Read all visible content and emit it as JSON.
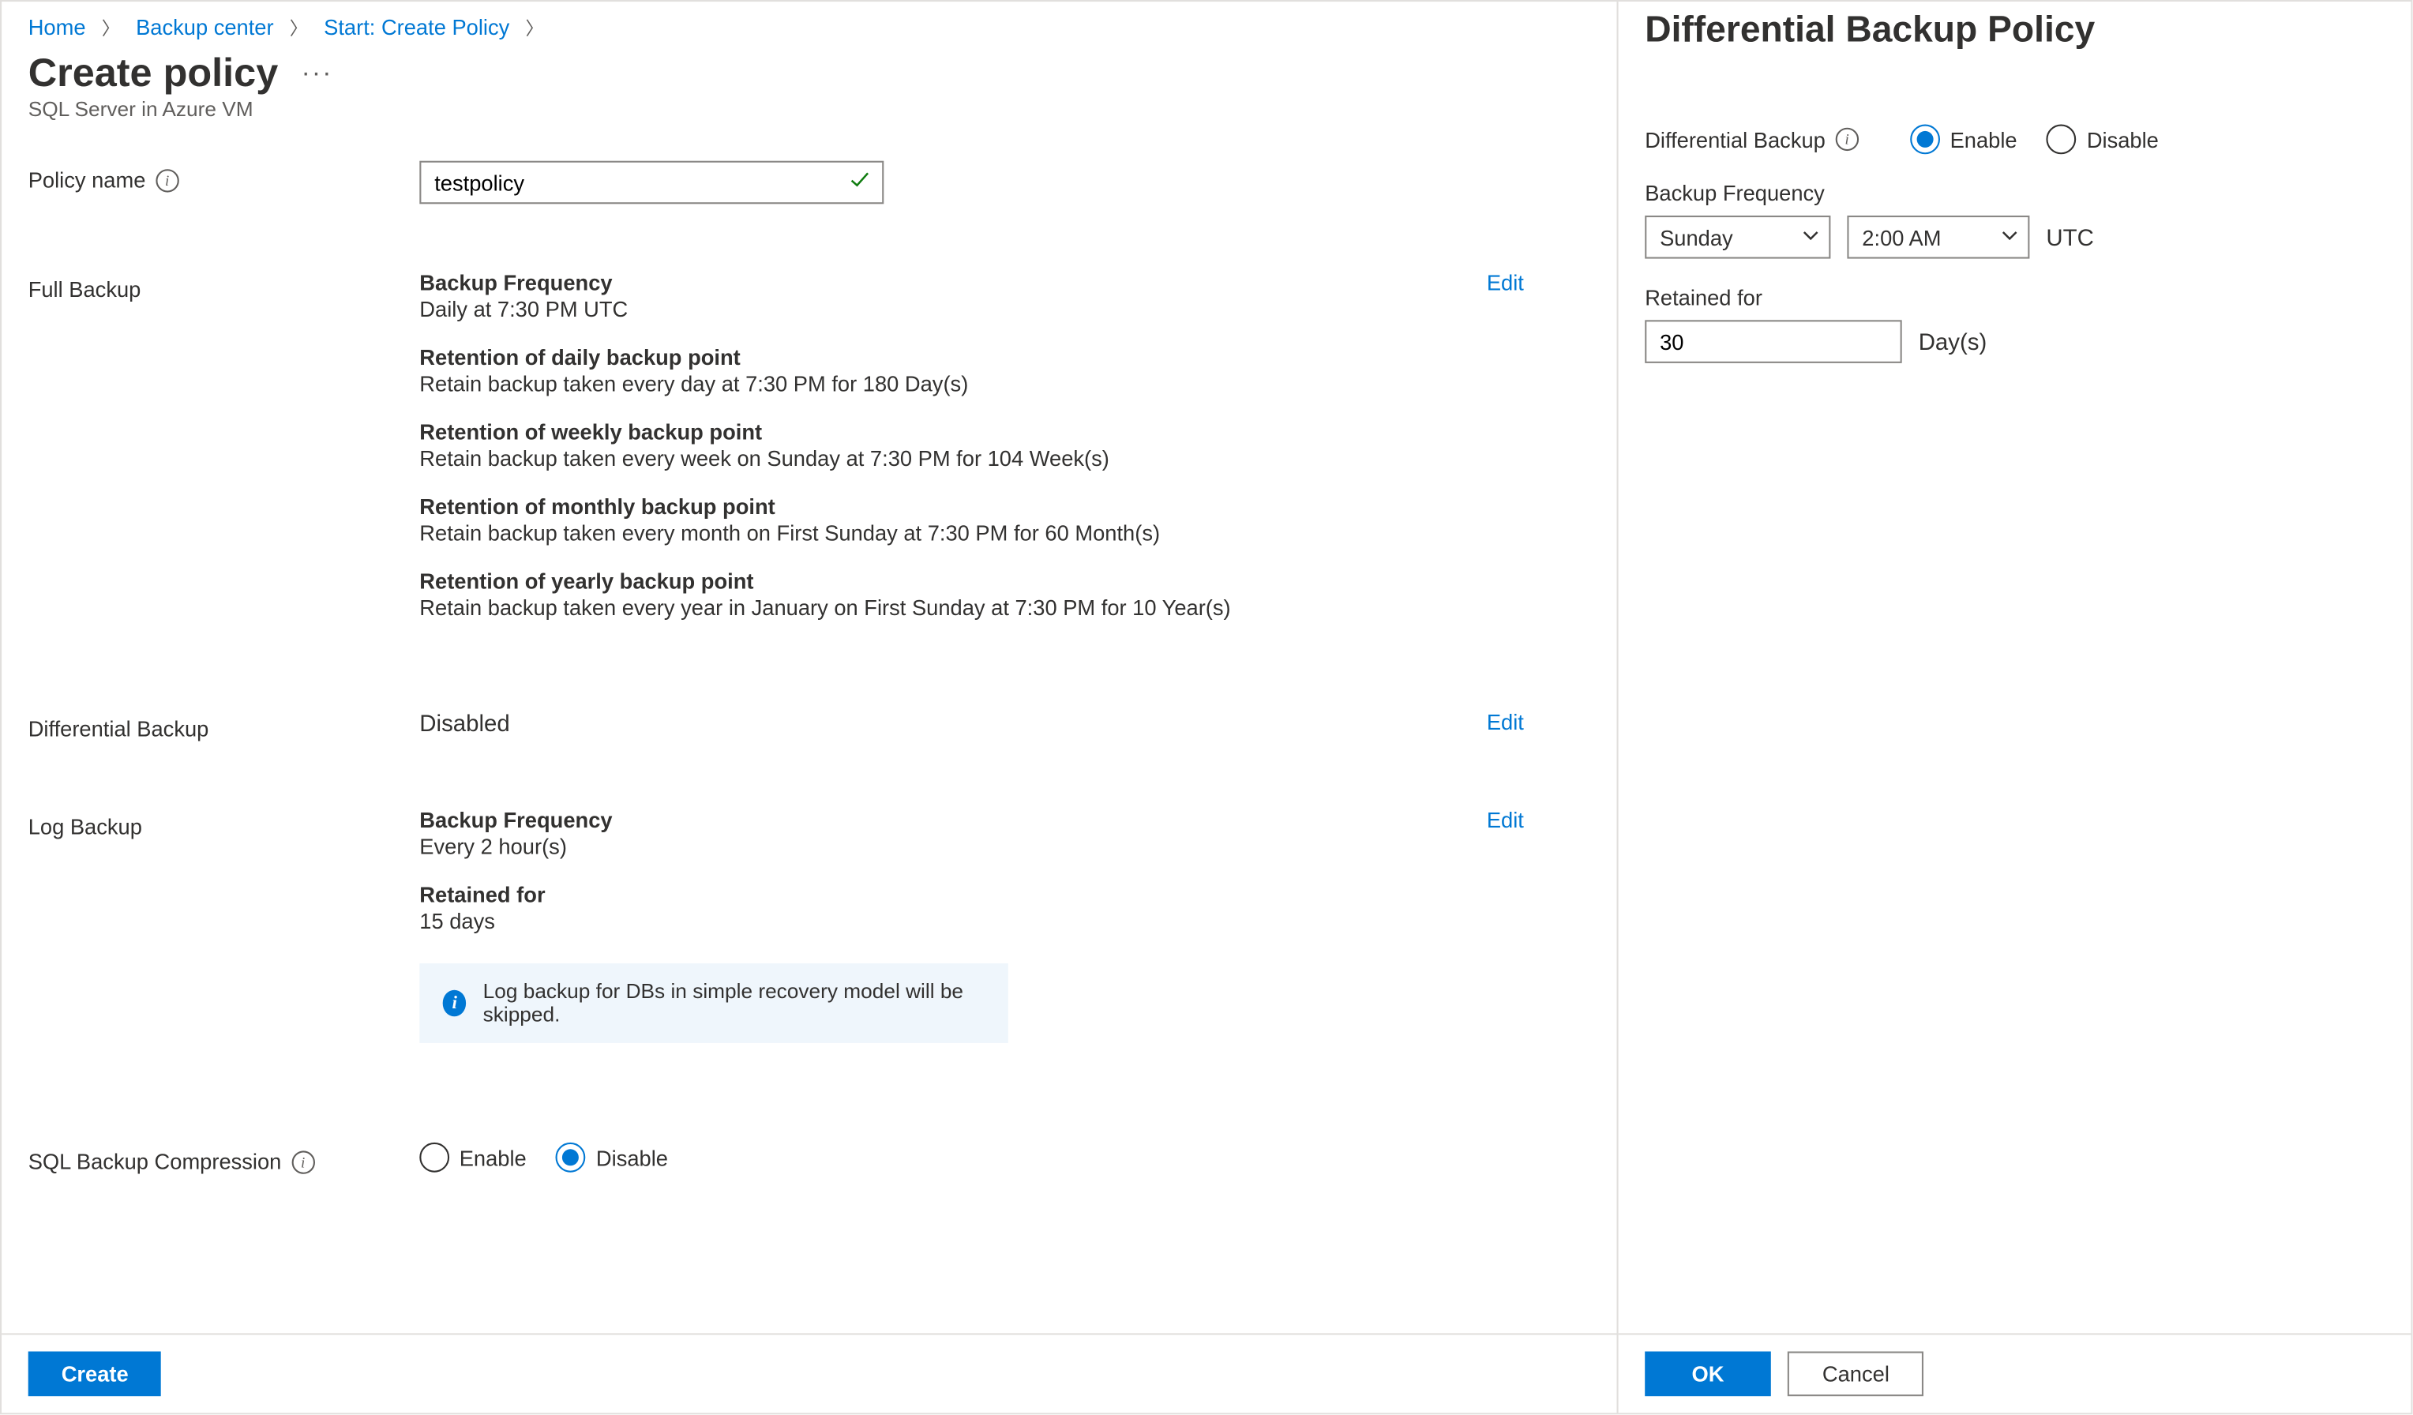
{
  "breadcrumb": {
    "home": "Home",
    "backup_center": "Backup center",
    "start": "Start: Create Policy"
  },
  "page": {
    "title": "Create policy",
    "subtitle": "SQL Server in Azure VM"
  },
  "policy_name": {
    "label": "Policy name",
    "value": "testpolicy"
  },
  "full_backup": {
    "label": "Full Backup",
    "edit": "Edit",
    "freq_label": "Backup Frequency",
    "freq_value": "Daily at 7:30 PM UTC",
    "daily_label": "Retention of daily backup point",
    "daily_value": "Retain backup taken every day at 7:30 PM for 180 Day(s)",
    "weekly_label": "Retention of weekly backup point",
    "weekly_value": "Retain backup taken every week on Sunday at 7:30 PM for 104 Week(s)",
    "monthly_label": "Retention of monthly backup point",
    "monthly_value": "Retain backup taken every month on First Sunday at 7:30 PM for 60 Month(s)",
    "yearly_label": "Retention of yearly backup point",
    "yearly_value": "Retain backup taken every year in January on First Sunday at 7:30 PM for 10 Year(s)"
  },
  "diff_backup_row": {
    "label": "Differential Backup",
    "value": "Disabled",
    "edit": "Edit"
  },
  "log_backup": {
    "label": "Log Backup",
    "edit": "Edit",
    "freq_label": "Backup Frequency",
    "freq_value": "Every 2 hour(s)",
    "ret_label": "Retained for",
    "ret_value": "15 days",
    "info": "Log backup for DBs in simple recovery model will be skipped."
  },
  "compression": {
    "label": "SQL Backup Compression",
    "enable": "Enable",
    "disable": "Disable"
  },
  "create_btn": "Create",
  "right": {
    "title": "Differential Backup Policy",
    "diff_label": "Differential Backup",
    "enable": "Enable",
    "disable": "Disable",
    "freq_label": "Backup Frequency",
    "day": "Sunday",
    "time": "2:00 AM",
    "tz": "UTC",
    "retained_label": "Retained for",
    "retained_value": "30",
    "retained_unit": "Day(s)",
    "ok": "OK",
    "cancel": "Cancel"
  }
}
